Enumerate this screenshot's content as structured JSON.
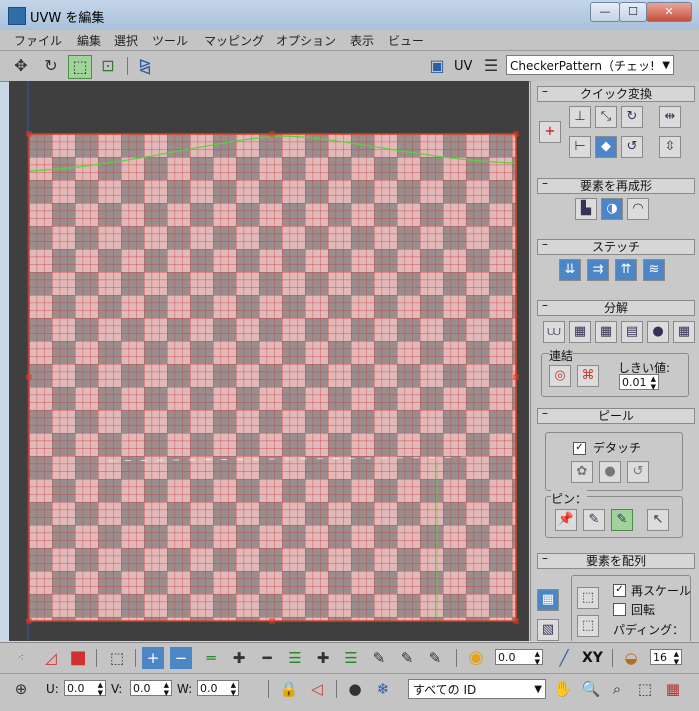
{
  "window": {
    "title": "UVW を編集",
    "controls": {
      "minimize": "—",
      "maximize": "☐",
      "close": "✕"
    }
  },
  "menu": [
    "ファイル",
    "編集",
    "選択",
    "ツール",
    "マッピング",
    "オプション",
    "表示",
    "ビュー"
  ],
  "toolbar": {
    "uv_label": "UV",
    "map_select": "CheckerPattern（チェッ!"
  },
  "colors": {
    "checker_light": "#e3b8b8",
    "checker_dark": "#9a8d8d",
    "grid_line": "#c54040",
    "seam_green": "#55d43a",
    "viewport_bg": "#3f3f3f",
    "active_green": "#9fd39a",
    "accent_blue": "#4d86c6",
    "bounds_red": "#e03a1e"
  },
  "panel": {
    "quick_transform": {
      "title": "クイック変換"
    },
    "reshape": {
      "title": "要素を再成形"
    },
    "stitch": {
      "title": "ステッチ"
    },
    "explode": {
      "title": "分解",
      "weld_label": "連結",
      "threshold_label": "しきい値:",
      "threshold_value": "0.01"
    },
    "peel": {
      "title": "ピール",
      "detach_label": "デタッチ",
      "pin_label": "ピン："
    },
    "arrange": {
      "title": "要素を配列",
      "rescale_label": "再スケール",
      "rotate_label": "回転",
      "padding_label": "パディング："
    }
  },
  "bottom": {
    "spinner1": "0.0",
    "xy_label": "XY",
    "spinner2": "16",
    "u_label": "U:",
    "u_value": "0.0",
    "v_label": "V:",
    "v_value": "0.0",
    "w_label": "W:",
    "w_value": "0.0",
    "id_select": "すべての ID"
  }
}
